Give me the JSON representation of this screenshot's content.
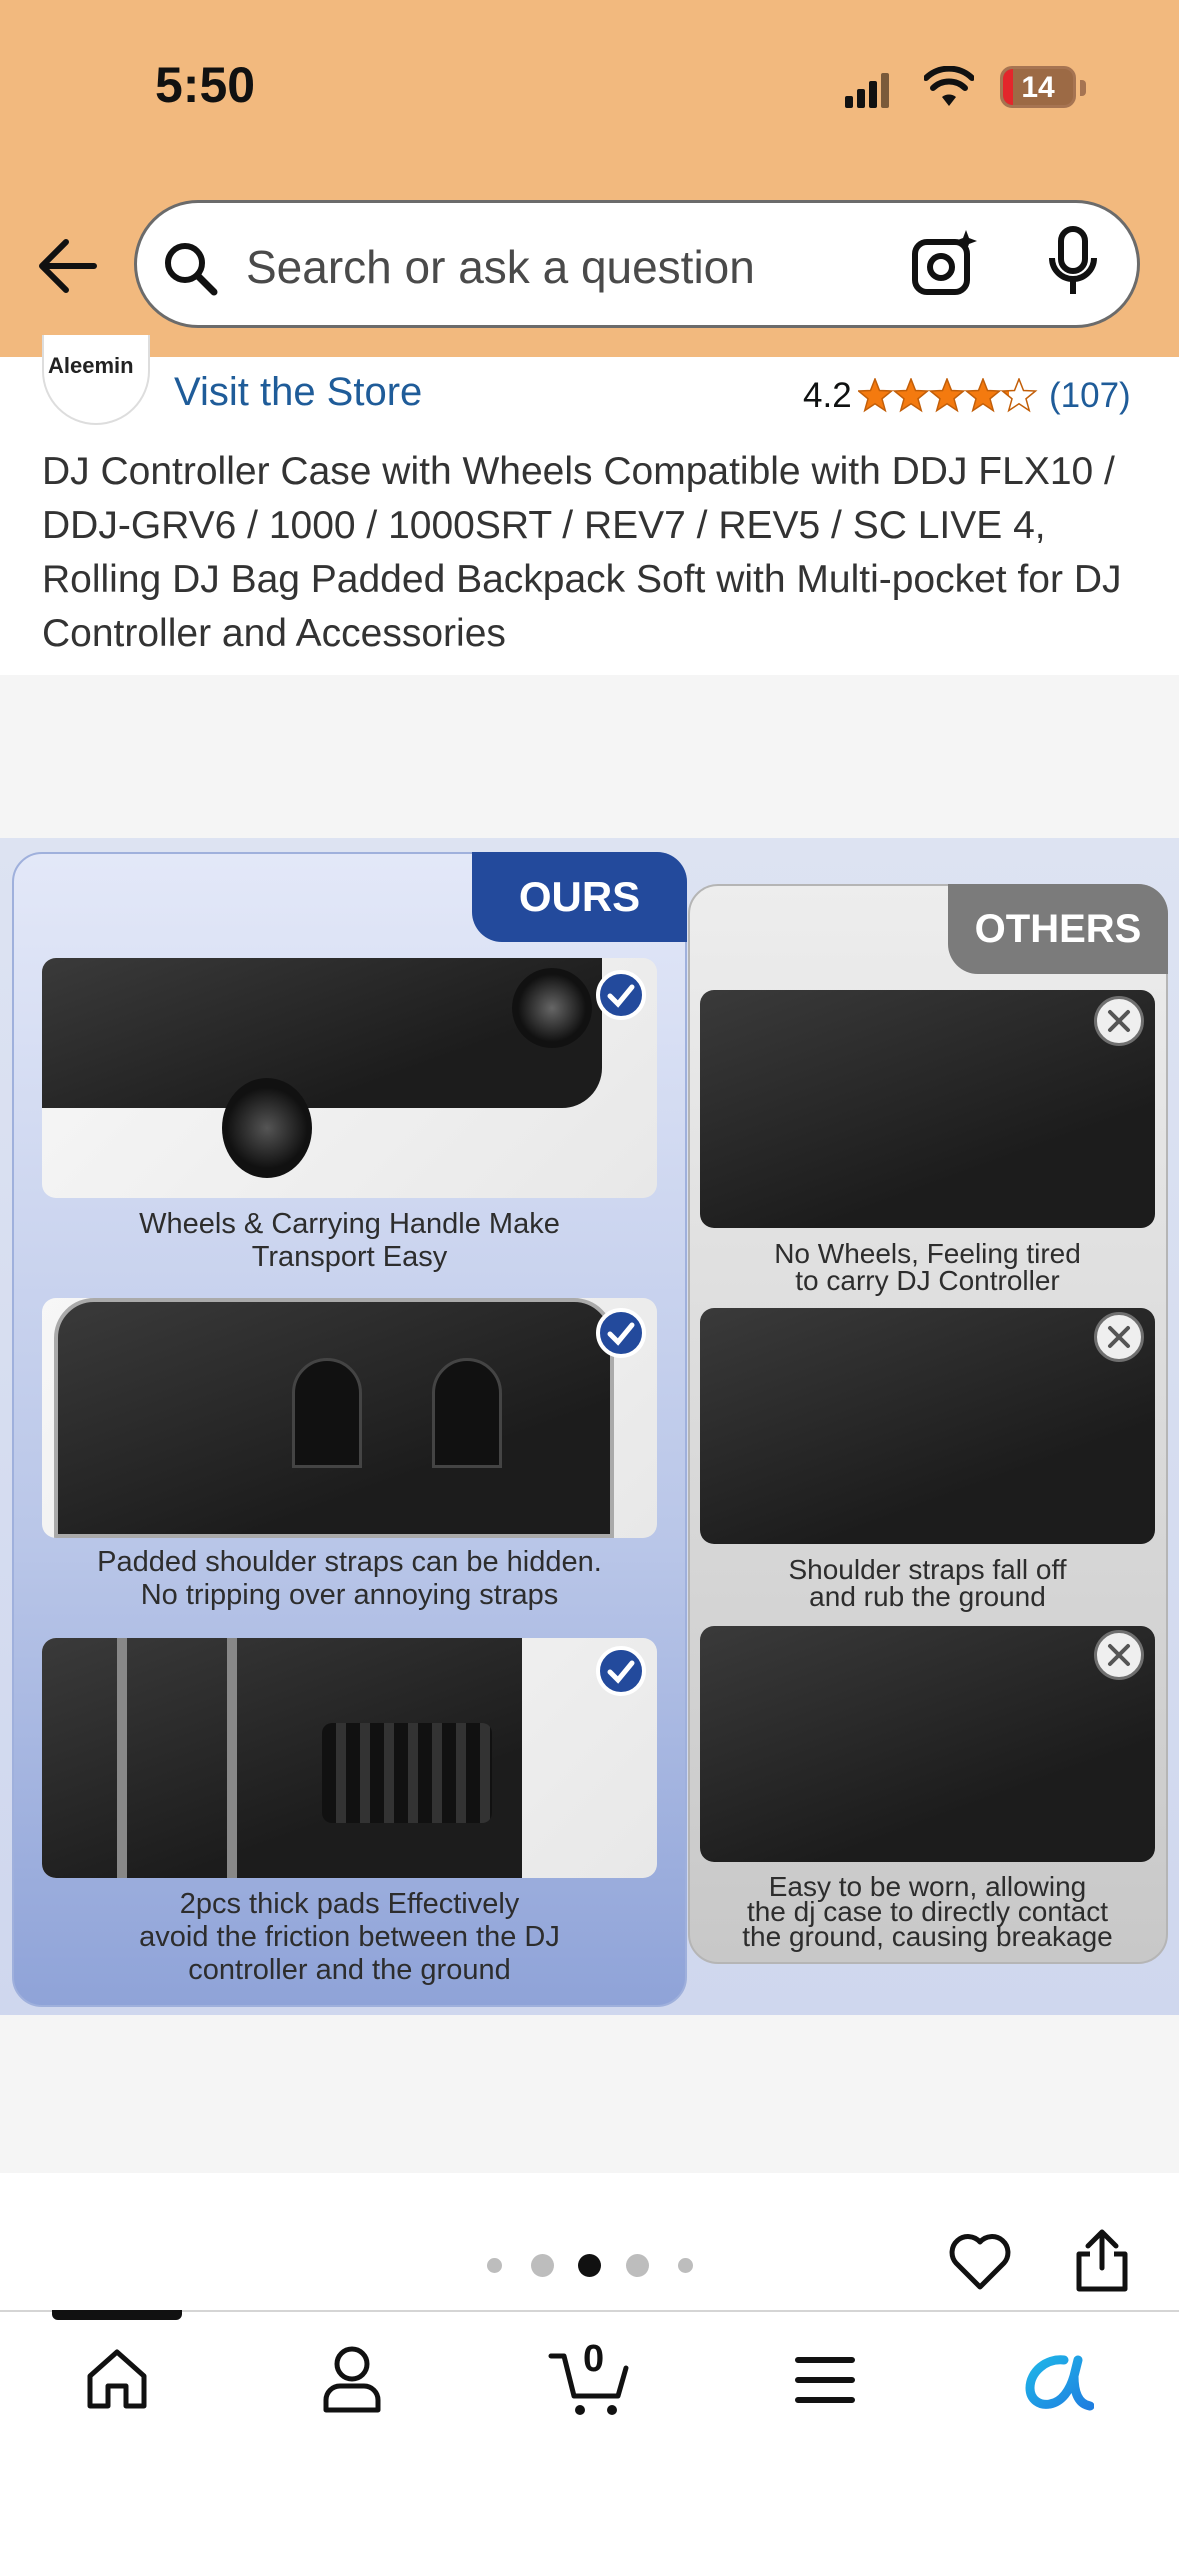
{
  "status_bar": {
    "time": "5:50",
    "battery": "14"
  },
  "search": {
    "placeholder": "Search or ask a question"
  },
  "product": {
    "store_logo_text": "Aleemin",
    "visit_store": "Visit the Store",
    "rating": "4.2",
    "stars": 4.2,
    "rating_count": "(107)",
    "title": "DJ Controller Case with Wheels Compatible with DDJ FLX10 / DDJ-GRV6 / 1000 / 1000SRT / REV7 / REV5 / SC LIVE 4, Rolling DJ Bag Padded Backpack Soft with Multi-pocket for DJ Controller and Accessories"
  },
  "comparison": {
    "ours_label": "OURS",
    "others_label": "OTHERS",
    "ours_captions": [
      [
        "Wheels & Carrying Handle Make",
        "Transport Easy"
      ],
      [
        "Padded shoulder straps can be hidden.",
        "No tripping over annoying straps"
      ],
      [
        "2pcs thick pads Effectively",
        "avoid the friction between the DJ",
        "controller and the ground"
      ]
    ],
    "others_captions": [
      [
        "No Wheels, Feeling tired",
        "to carry DJ Controller"
      ],
      [
        "Shoulder straps fall off",
        "and rub the ground"
      ],
      [
        "Easy to be worn, allowing",
        "the dj case to directly contact",
        "the ground, causing breakage"
      ]
    ]
  },
  "carousel": {
    "total": 5,
    "active_index": 2
  },
  "bottom_nav": {
    "cart_count": "0"
  },
  "colors": {
    "header_bg": "#f2b97e",
    "link": "#1f5c99",
    "star": "#f47a0f",
    "ours_blue": "#234a9c"
  },
  "icons": [
    "back-arrow-icon",
    "search-icon",
    "camera-icon",
    "microphone-icon",
    "heart-icon",
    "share-icon",
    "home-icon",
    "account-icon",
    "cart-icon",
    "menu-icon",
    "rufus-icon"
  ]
}
